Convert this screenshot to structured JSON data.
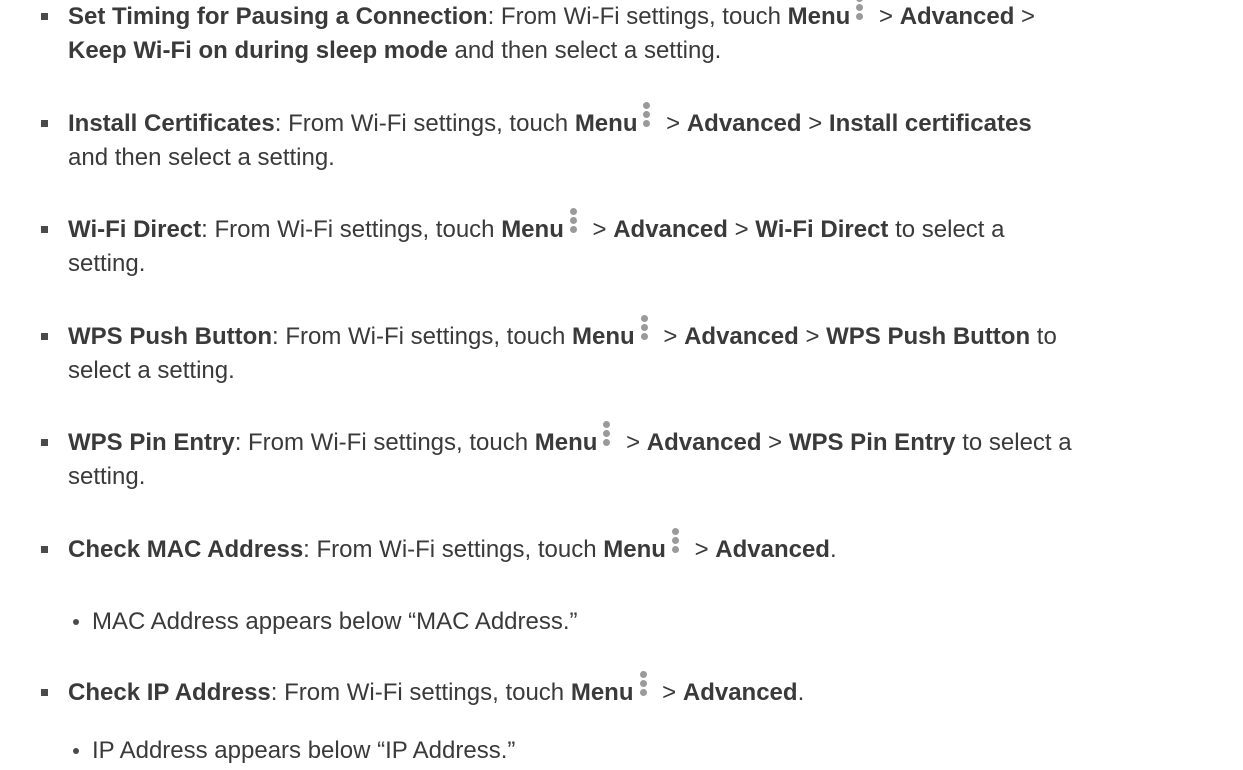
{
  "items": [
    {
      "title": "Set Timing for Pausing a Connection",
      "intro": ": From Wi-Fi settings, touch ",
      "menu": "Menu",
      "sep1": " > ",
      "advanced": "Advanced",
      "sep2": " >",
      "target": "Keep Wi-Fi on during sleep mode",
      "tail": " and then select a setting."
    },
    {
      "title": "Install Certificates",
      "intro": ": From Wi-Fi settings, touch ",
      "menu": "Menu",
      "sep1": " > ",
      "advanced": "Advanced",
      "sep2": " > ",
      "target": "Install certificates",
      "tail": "and then select a setting."
    },
    {
      "title": "Wi-Fi Direct",
      "intro": ": From Wi-Fi settings, touch ",
      "menu": "Menu",
      "sep1": " > ",
      "advanced": "Advanced",
      "sep2": " > ",
      "target": "Wi-Fi Direct",
      "tail_a": " to select a",
      "tail": "setting."
    },
    {
      "title": "WPS Push Button",
      "intro": ": From Wi-Fi settings, touch ",
      "menu": "Menu",
      "sep1": " > ",
      "advanced": "Advanced",
      "sep2": " > ",
      "target": "WPS Push Button",
      "tail_a": " to",
      "tail": "select a setting."
    },
    {
      "title": "WPS Pin Entry",
      "intro": ": From Wi-Fi settings, touch ",
      "menu": "Menu",
      "sep1": " > ",
      "advanced": "Advanced",
      "sep2": " > ",
      "target": "WPS Pin Entry",
      "tail_a": " to select a",
      "tail": "setting."
    },
    {
      "title": "Check MAC Address",
      "intro": ": From Wi-Fi settings, touch ",
      "menu": "Menu",
      "sep1": " > ",
      "advanced": "Advanced",
      "end": ".",
      "sub": "MAC Address appears below “MAC Address.”"
    },
    {
      "title": "Check IP Address",
      "intro": ": From Wi-Fi settings, touch ",
      "menu": "Menu",
      "sep1": " > ",
      "advanced": "Advanced",
      "end": ".",
      "sub": "IP Address appears below “IP Address.”"
    }
  ],
  "icons": {
    "menu": "vertical-dots-menu-icon"
  },
  "colors": {
    "text": "#3a3a3a",
    "bullet": "#4a4a4a",
    "icon": "#9a9a9a"
  }
}
